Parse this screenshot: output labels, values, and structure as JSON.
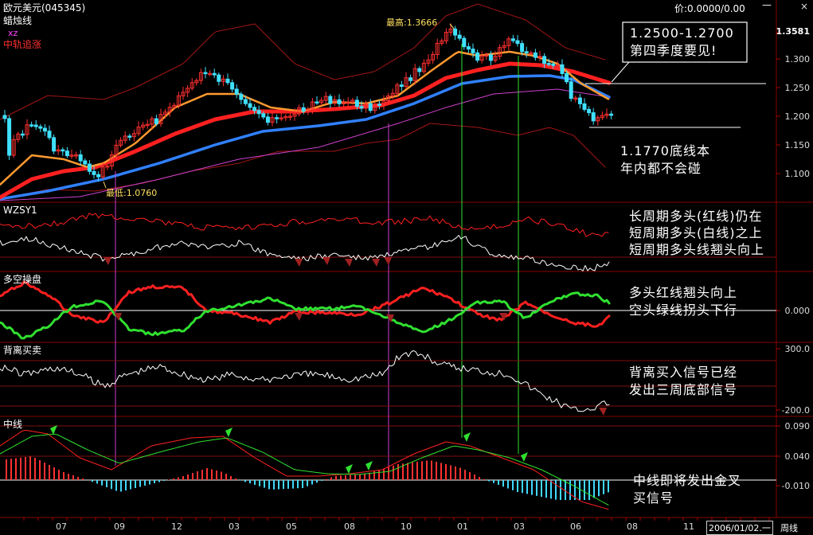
{
  "header": {
    "instrument": "欧元美元(045345)",
    "indicator_candle": "蜡烛线",
    "indicator_xz": "xz",
    "indicator_mid": "中轨追涨",
    "price_readout": "价:0.0000/0.00",
    "high_label": "最高:1.3666",
    "low_label": "最低:1.0760"
  },
  "panels": {
    "wzsy1": "WZSY1",
    "duokong": "多空操盘",
    "beili": "背离买卖",
    "zhongxian": "中线"
  },
  "price_axis": [
    "1.3581",
    "1.300",
    "1.250",
    "1.200",
    "1.150",
    "1.100"
  ],
  "wzsy_axis": [],
  "duokong_axis": [
    "0.000"
  ],
  "beili_axis": [
    "300.0",
    "-200.0"
  ],
  "zhongxian_axis": [
    "0.090",
    "0.040",
    "-0.010"
  ],
  "time_axis": [
    "07",
    "09",
    "12",
    "03",
    "05",
    "08",
    "10",
    "01",
    "03",
    "06",
    "08",
    "11",
    "2006/01/02.一",
    "周线"
  ],
  "annotations": {
    "box_line1": "1.2500-1.2700",
    "box_line2": "第四季度要见!",
    "bottom_line1": "1.1770底线本",
    "bottom_line2": "年内都不会碰",
    "wzsy_line1": "长周期多头(红线)仍在",
    "wzsy_line2": "短周期多头(白线)之上",
    "wzsy_line3": "短周期多头线翘头向上",
    "dk_line1": "多头红线翘头向上",
    "dk_line2": "空头绿线拐头下行",
    "bl_line1": "背离买入信号已经",
    "bl_line2": "发出三周底部信号",
    "zx_line1": "中线即将发出金叉",
    "zx_line2": "买信号"
  },
  "window_controls": [
    "—",
    "×"
  ],
  "colors": {
    "background": "#000000",
    "bull_candle": "#ff3030",
    "bear_candle": "#40e0ff",
    "red_line": "#ff2020",
    "orange_line": "#ff9a30",
    "blue_line": "#3080ff",
    "magenta": "#cc40cc",
    "green": "#30e030",
    "grid_red": "#801010"
  }
}
